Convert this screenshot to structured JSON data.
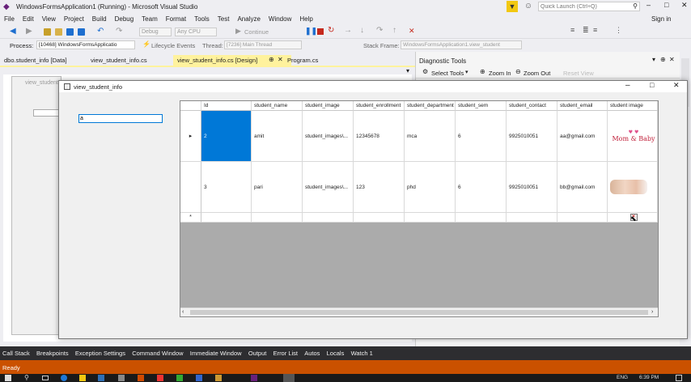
{
  "window": {
    "title": "WindowsFormsApplication1 (Running) - Microsoft Visual Studio",
    "quick_launch_placeholder": "Quick Launch (Ctrl+Q)",
    "sign_in": "Sign in"
  },
  "menu": [
    "File",
    "Edit",
    "View",
    "Project",
    "Build",
    "Debug",
    "Team",
    "Format",
    "Tools",
    "Test",
    "Analyze",
    "Window",
    "Help"
  ],
  "toolbar": {
    "config": "Debug",
    "platform": "Any CPU",
    "continue": "Continue",
    "process_label": "Process:",
    "process_value": "[10468] WindowsFormsApplicatio",
    "lifecycle": "Lifecycle Events",
    "thread_label": "Thread:",
    "thread_value": "[7236] Main Thread",
    "stack_label": "Stack Frame:",
    "stack_value": "WindowsFormsApplication1.view_student"
  },
  "doc_tabs": [
    "dbo.student_info [Data]",
    "view_student_info.cs",
    "view_student_info.cs [Design]",
    "Program.cs"
  ],
  "designer_ghost_title": "view_student",
  "diagnostic": {
    "title": "Diagnostic Tools",
    "select_tools": "Select Tools",
    "zoom_in": "Zoom In",
    "zoom_out": "Zoom Out",
    "reset_view": "Reset View"
  },
  "form": {
    "title": "view_student_info",
    "search_value": "a"
  },
  "grid": {
    "columns": [
      "Id",
      "student_name",
      "student_image",
      "student_enrollment",
      "student_department",
      "student_sem",
      "student_contact",
      "student_email",
      "student image"
    ],
    "rows": [
      {
        "id": "2",
        "name": "amit",
        "image": "student_images\\...",
        "enrollment": "12345678",
        "department": "mca",
        "sem": "6",
        "contact": "9925010051",
        "email": "aa@gmail.com",
        "thumb_text": "Mom & Baby"
      },
      {
        "id": "3",
        "name": "pari",
        "image": "student_images\\...",
        "enrollment": "123",
        "department": "phd",
        "sem": "6",
        "contact": "9925010051",
        "email": "bb@gmail.com",
        "thumb_text": ""
      }
    ],
    "new_row_marker": "*",
    "current_row_marker": "▸"
  },
  "bottom_tabs": [
    "Call Stack",
    "Breakpoints",
    "Exception Settings",
    "Command Window",
    "Immediate Window",
    "Output",
    "Error List",
    "Autos",
    "Locals",
    "Watch 1"
  ],
  "status": "Ready",
  "clock": "6:39 PM",
  "lang": "ENG"
}
